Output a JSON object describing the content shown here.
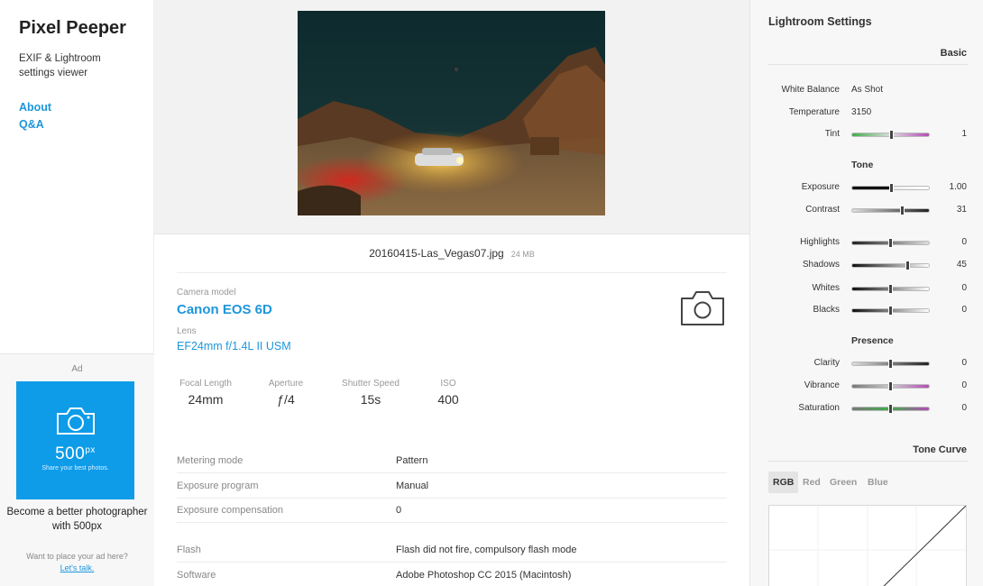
{
  "brand": {
    "name": "Pixel Peeper",
    "tagline": "EXIF & Lightroom settings viewer"
  },
  "nav": {
    "about": "About",
    "qa": "Q&A"
  },
  "ad": {
    "label": "Ad",
    "logo": "500",
    "logo_sup": "px",
    "tagline": "Share your best photos.",
    "copy": "Become a better photographer with 500px",
    "place_text": "Want to place your ad here?",
    "place_link": "Let's talk."
  },
  "photo": {
    "filename": "20160415-Las_Vegas07.jpg",
    "size": "24 MB"
  },
  "camera": {
    "model_label": "Camera model",
    "model": "Canon EOS 6D",
    "lens_label": "Lens",
    "lens": "EF24mm f/1.4L II USM"
  },
  "stats": [
    {
      "label": "Focal Length",
      "value": "24mm"
    },
    {
      "label": "Aperture",
      "value": "ƒ/4"
    },
    {
      "label": "Shutter Speed",
      "value": "15s"
    },
    {
      "label": "ISO",
      "value": "400"
    }
  ],
  "exif_rows": [
    {
      "key": "Metering mode",
      "value": "Pattern"
    },
    {
      "key": "Exposure program",
      "value": "Manual"
    },
    {
      "key": "Exposure compensation",
      "value": "0"
    },
    {
      "key": "Flash",
      "value": "Flash did not fire, compulsory flash mode"
    },
    {
      "key": "Software",
      "value": "Adobe Photoshop CC 2015 (Macintosh)"
    }
  ],
  "lightroom": {
    "title": "Lightroom Settings",
    "basic": "Basic",
    "white_balance": {
      "label": "White Balance",
      "value": "As Shot"
    },
    "temperature": {
      "label": "Temperature",
      "value": "3150"
    },
    "tint": {
      "label": "Tint",
      "value": "1",
      "level": 0.52
    },
    "tone_head": "Tone",
    "tone": [
      {
        "label": "Exposure",
        "value": "1.00",
        "level": 0.52,
        "style": "exp"
      },
      {
        "label": "Contrast",
        "value": "31",
        "level": 0.66,
        "style": "light"
      }
    ],
    "tone2": [
      {
        "label": "Highlights",
        "value": "0",
        "level": 0.5,
        "style": "dark"
      },
      {
        "label": "Shadows",
        "value": "45",
        "level": 0.73,
        "style": "black"
      },
      {
        "label": "Whites",
        "value": "0",
        "level": 0.5,
        "style": "white"
      },
      {
        "label": "Blacks",
        "value": "0",
        "level": 0.5,
        "style": "black"
      }
    ],
    "presence_head": "Presence",
    "presence": [
      {
        "label": "Clarity",
        "value": "0",
        "level": 0.5,
        "style": "light"
      },
      {
        "label": "Vibrance",
        "value": "0",
        "level": 0.5,
        "style": "vib"
      },
      {
        "label": "Saturation",
        "value": "0",
        "level": 0.5,
        "style": "sat"
      }
    ],
    "tone_curve": "Tone Curve",
    "curve_tabs": [
      "RGB",
      "Red",
      "Green",
      "Blue"
    ]
  }
}
